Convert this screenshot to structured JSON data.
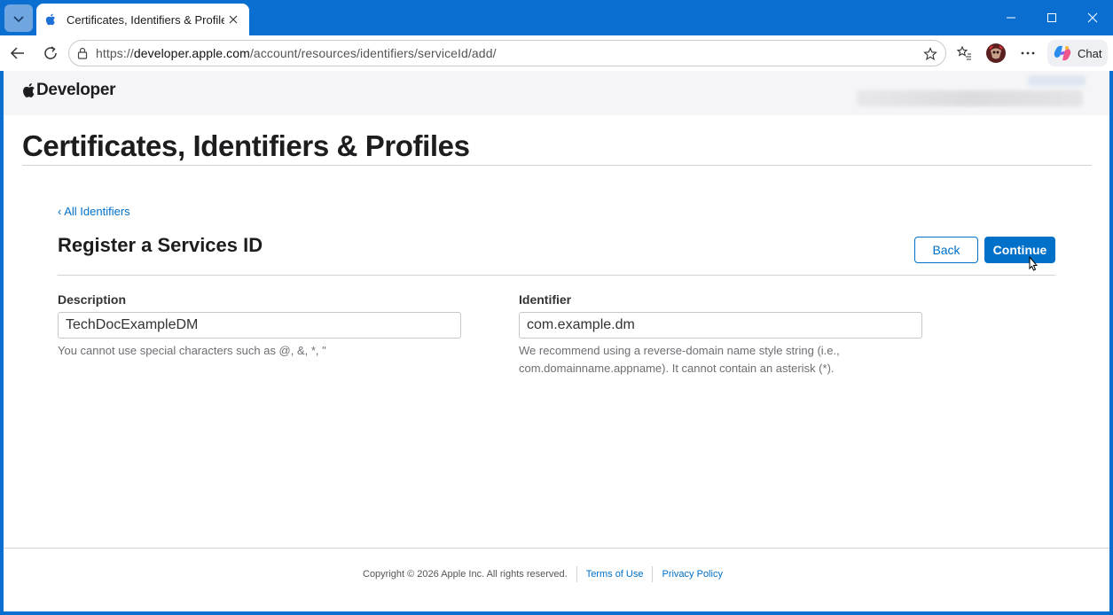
{
  "browser": {
    "tab_title": "Certificates, Identifiers & Profiles -",
    "url_prefix": "https://",
    "url_host": "developer.apple.com",
    "url_path": "/account/resources/identifiers/serviceId/add/",
    "chat_label": "Chat"
  },
  "header": {
    "logo_text": "Developer"
  },
  "page": {
    "title": "Certificates, Identifiers & Profiles",
    "back_link": "‹ All Identifiers",
    "section_title": "Register a Services ID",
    "back_button": "Back",
    "continue_button": "Continue"
  },
  "form": {
    "description": {
      "label": "Description",
      "value": "TechDocExampleDM",
      "help": "You cannot use special characters such as @, &, *, \""
    },
    "identifier": {
      "label": "Identifier",
      "value": "com.example.dm",
      "help_line1": "We recommend using a reverse-domain name style string (i.e.,",
      "help_line2": "com.domainname.appname). It cannot contain an asterisk (*)."
    }
  },
  "footer": {
    "copyright": "Copyright © 2026 Apple Inc. All rights reserved.",
    "terms": "Terms of Use",
    "privacy": "Privacy Policy"
  },
  "colors": {
    "accent": "#0070c9",
    "titlebar": "#0a6fd0"
  }
}
